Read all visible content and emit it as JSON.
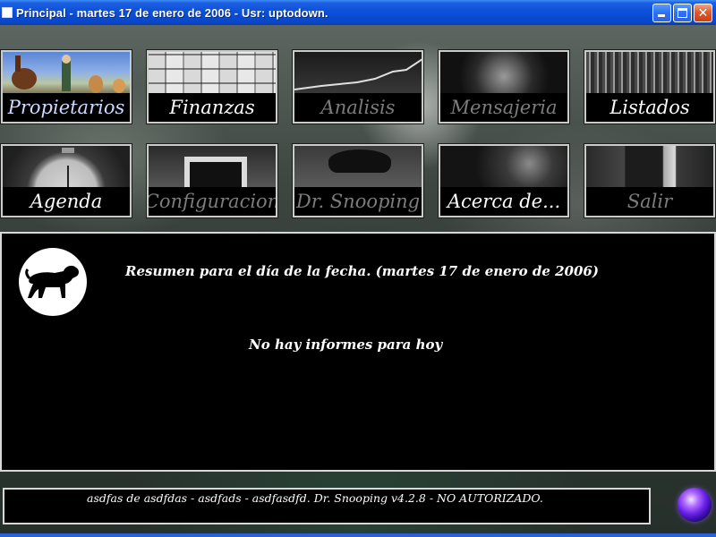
{
  "window": {
    "title": "Principal - martes 17 de enero de 2006 - Usr: uptodown."
  },
  "modules": [
    {
      "id": "propietarios",
      "label": "Propietarios",
      "icon": "owners-photo-icon",
      "enabled": true
    },
    {
      "id": "finanzas",
      "label": "Finanzas",
      "icon": "money-bills-icon",
      "enabled": true
    },
    {
      "id": "analisis",
      "label": "Analisis",
      "icon": "line-chart-icon",
      "enabled": false
    },
    {
      "id": "mensajeria",
      "label": "Mensajeria",
      "icon": "globe-icon",
      "enabled": false
    },
    {
      "id": "listados",
      "label": "Listados",
      "icon": "list-icon",
      "enabled": true
    },
    {
      "id": "agenda",
      "label": "Agenda",
      "icon": "clock-icon",
      "enabled": true
    },
    {
      "id": "configuracion",
      "label": "Configuracion",
      "icon": "monitor-icon",
      "enabled": false
    },
    {
      "id": "drsnooping",
      "label": "Dr. Snooping",
      "icon": "detective-dog-icon",
      "enabled": false
    },
    {
      "id": "acerca",
      "label": "Acerca de...",
      "icon": "question-icon",
      "enabled": true
    },
    {
      "id": "salir",
      "label": "Salir",
      "icon": "door-icon",
      "enabled": false
    }
  ],
  "summary": {
    "header": "Resumen para el día de la fecha. (martes 17 de enero de 2006)",
    "empty_message": "No hay informes para hoy"
  },
  "status": {
    "text": "asdfas de asdfdas - asdfads - asdfasdfd. Dr. Snooping v4.2.8 - NO AUTORIZADO."
  },
  "colors": {
    "titlebar": "#0b4fd8",
    "panel_bg": "#000000",
    "panel_border": "#d8d8d8",
    "label_enabled": "#ffffff",
    "label_disabled": "#7c7c7c",
    "orb": "#6a22e8"
  }
}
